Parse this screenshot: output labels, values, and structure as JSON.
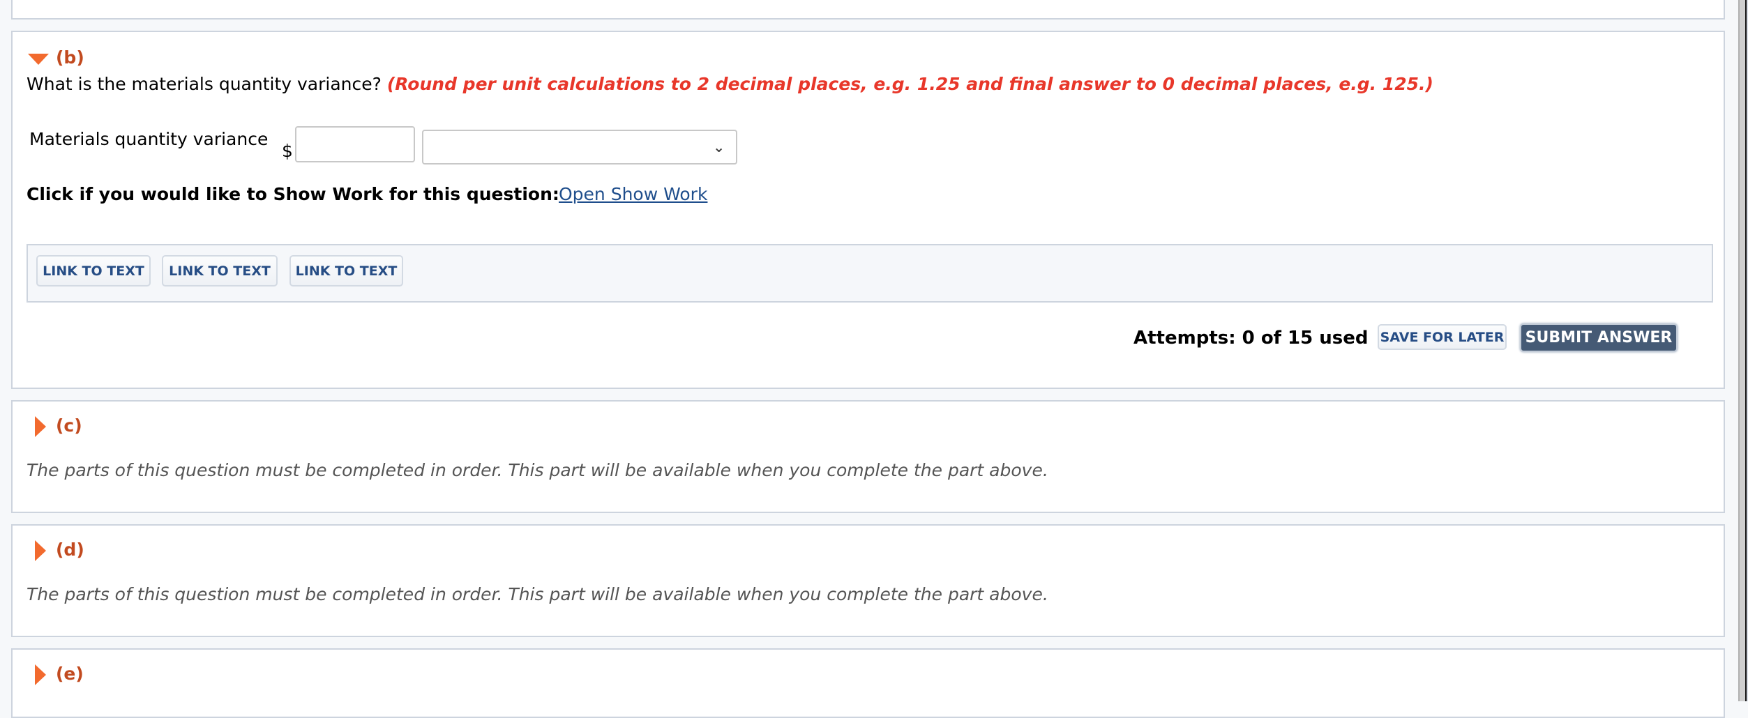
{
  "part_b": {
    "label": "(b)",
    "expanded": true,
    "question": "What is the materials quantity variance?",
    "hint": "(Round per unit calculations to 2 decimal places, e.g. 1.25 and final answer to 0 decimal places, e.g. 125.)",
    "field_label": "Materials quantity variance",
    "currency_symbol": "$",
    "amount_value": "",
    "type_select_value": "",
    "show_work_prompt": "Click if you would like to Show Work for this question:",
    "show_work_link": "Open Show Work",
    "link_buttons": [
      "LINK TO TEXT",
      "LINK TO TEXT",
      "LINK TO TEXT"
    ],
    "attempts": "Attempts: 0 of 15 used",
    "save_label": "SAVE FOR LATER",
    "submit_label": "SUBMIT ANSWER"
  },
  "part_c": {
    "label": "(c)",
    "expanded": false,
    "message": "The parts of this question must be completed in order. This part will be available when you complete the part above."
  },
  "part_d": {
    "label": "(d)",
    "expanded": false,
    "message": "The parts of this question must be completed in order. This part will be available when you complete the part above."
  },
  "part_e": {
    "label": "(e)",
    "expanded": false
  },
  "colors": {
    "accent_orange": "#f26a2e",
    "part_label": "#c24a1f",
    "hint_red": "#e8372a",
    "link_blue": "#264d85",
    "submit_bg": "#455a75"
  }
}
